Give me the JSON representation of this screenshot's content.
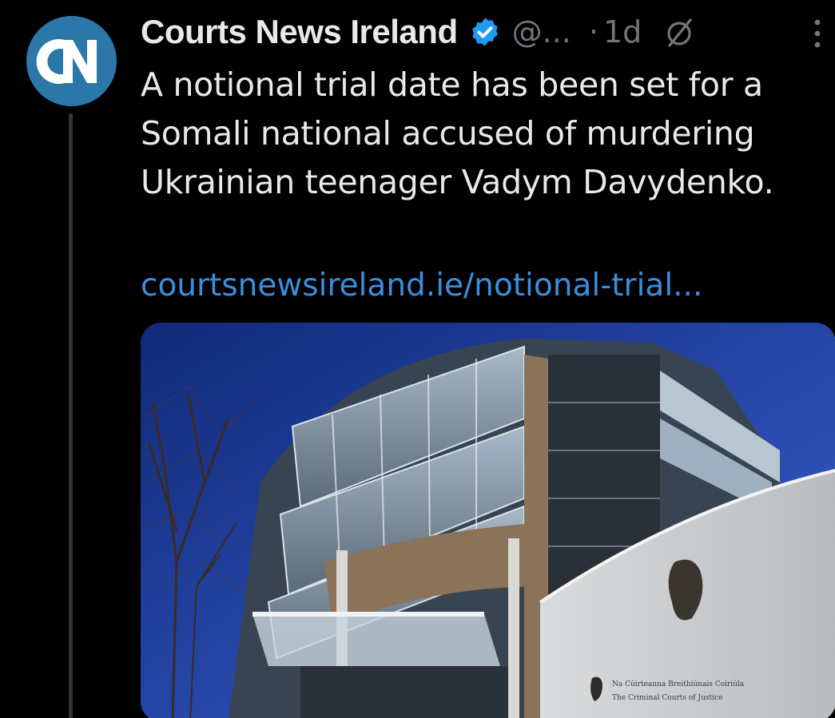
{
  "author": {
    "display_name": "Courts News Ireland",
    "handle": "@...",
    "avatar_text": "CN"
  },
  "meta": {
    "separator": "·",
    "timestamp": "1d"
  },
  "tweet": {
    "text": "A notional trial date has been set for a Somali national accused of murdering Ukrainian teenager Vadym Davydenko.",
    "link": "courtsnewsireland.ie/notional-trial..."
  },
  "media": {
    "sign_line_1": "Na Cúirteanna Breithiúnais Coiriúla",
    "sign_line_2": "The Criminal Courts of Justice"
  },
  "colors": {
    "background": "#000000",
    "text": "#e7e9ea",
    "secondary": "#71767b",
    "link": "#3b8edb",
    "verified": "#1d9bf0",
    "avatar": "#2b78a8"
  },
  "icons": {
    "verified": "verified-badge-icon",
    "edited": "edit-slash-icon",
    "more": "more-vertical-icon"
  }
}
